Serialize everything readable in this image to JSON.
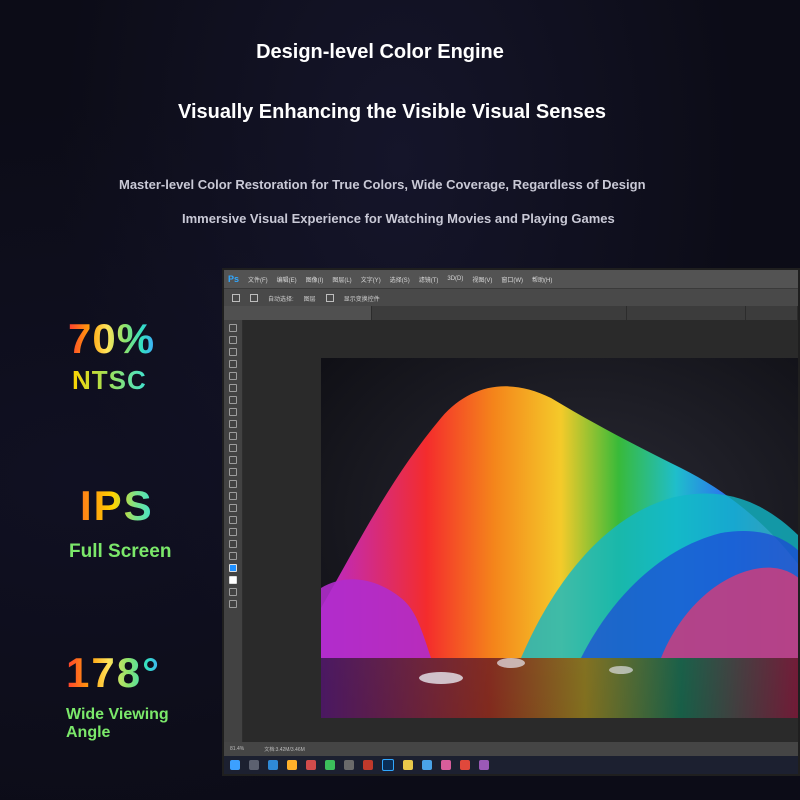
{
  "headline": {
    "title": "Design-level Color Engine",
    "subtitle": "Visually Enhancing the Visible Visual Senses"
  },
  "taglines": [
    "Master-level Color Restoration for True Colors, Wide Coverage, Regardless of Design",
    "Immersive Visual Experience for Watching Movies and Playing Games"
  ],
  "stats": [
    {
      "value": "70%",
      "label": "NTSC"
    },
    {
      "value": "IPS",
      "label": "Full Screen"
    },
    {
      "value": "178°",
      "label": "Wide Viewing Angle"
    }
  ],
  "photoshop": {
    "logo": "Ps",
    "menu_items": [
      "文件(F)",
      "编辑(E)",
      "图像(I)",
      "图层(L)",
      "文字(Y)",
      "选择(S)",
      "滤镜(T)",
      "3D(D)",
      "视图(V)",
      "窗口(W)",
      "帮助(H)"
    ],
    "options": {
      "auto_select": "自动选择:",
      "layer": "图层",
      "show_transform": "显示变换控件"
    },
    "zoom": "81.4%",
    "doc_info": "文档:3.42M/3.46M"
  },
  "colors": {
    "background": "#0c0c17",
    "ps_panel": "#535353",
    "taskbar": "#1c2030",
    "accent_green": "#7be86a"
  },
  "icons": [
    "photoshop-logo-icon",
    "move-tool-icon",
    "windows-start-icon",
    "search-icon",
    "browser-icon",
    "photoshop-taskbar-icon"
  ]
}
